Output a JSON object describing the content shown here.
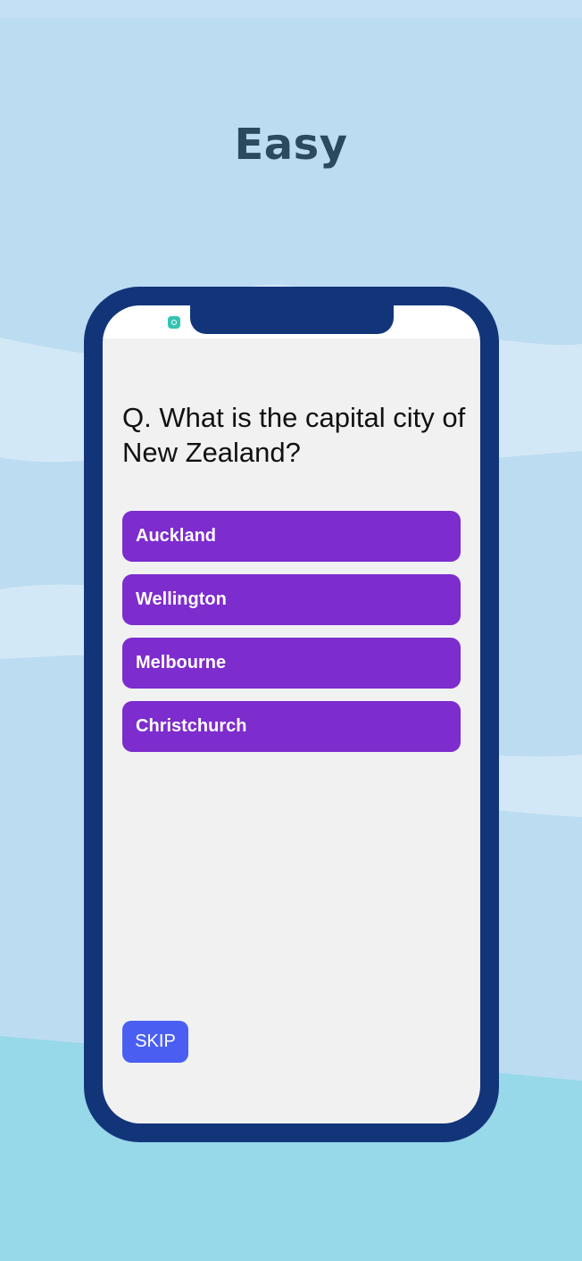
{
  "level": {
    "title": "Easy"
  },
  "quiz": {
    "question": "Q. What is the capital city of New Zealand?",
    "answers": [
      {
        "label": "Auckland"
      },
      {
        "label": "Wellington"
      },
      {
        "label": "Melbourne"
      },
      {
        "label": "Christchurch"
      }
    ],
    "skip_label": "SKIP"
  },
  "status_bar": {
    "icon": "app-notification-icon"
  },
  "colors": {
    "background": "#bcdcf1",
    "background_wave_light": "#d3e8f6",
    "background_bottom": "#97d8e9",
    "title_text": "#2c4a5e",
    "phone_frame": "#12357a",
    "screen": "#f1f1f2",
    "answer_button": "#7d2ccd",
    "skip_button": "#4a5ff2"
  }
}
